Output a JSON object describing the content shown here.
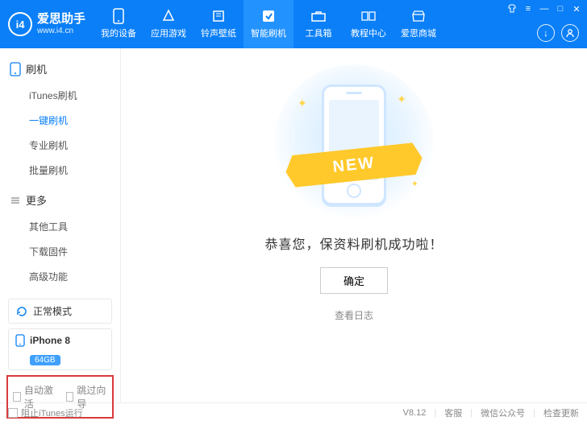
{
  "brand": {
    "name": "爱思助手",
    "url": "www.i4.cn",
    "logo_text": "i4"
  },
  "nav": [
    {
      "label": "我的设备",
      "icon": "device"
    },
    {
      "label": "应用游戏",
      "icon": "apps"
    },
    {
      "label": "铃声壁纸",
      "icon": "music"
    },
    {
      "label": "智能刷机",
      "icon": "flash",
      "active": true
    },
    {
      "label": "工具箱",
      "icon": "toolbox"
    },
    {
      "label": "教程中心",
      "icon": "book"
    },
    {
      "label": "爱思商城",
      "icon": "shop"
    }
  ],
  "win": {
    "skin": "skin",
    "menu": "≡",
    "min": "—",
    "max": "□",
    "close": "✕"
  },
  "circles": {
    "download": "↓",
    "user": "user"
  },
  "sidebar": {
    "group1": {
      "title": "刷机",
      "items": [
        "iTunes刷机",
        "一键刷机",
        "专业刷机",
        "批量刷机"
      ],
      "active_index": 1
    },
    "group2": {
      "title": "更多",
      "items": [
        "其他工具",
        "下载固件",
        "高级功能"
      ]
    },
    "mode": {
      "label": "正常模式"
    },
    "device": {
      "name": "iPhone 8",
      "storage": "64GB"
    },
    "redbox": {
      "opt1": "自动激活",
      "opt2": "跳过向导"
    }
  },
  "main": {
    "ribbon": "NEW",
    "success": "恭喜您，保资料刷机成功啦！",
    "ok": "确定",
    "view_log": "查看日志"
  },
  "status": {
    "block_itunes": "阻止iTunes运行",
    "version": "V8.12",
    "items": [
      "客服",
      "微信公众号",
      "检查更新"
    ]
  }
}
